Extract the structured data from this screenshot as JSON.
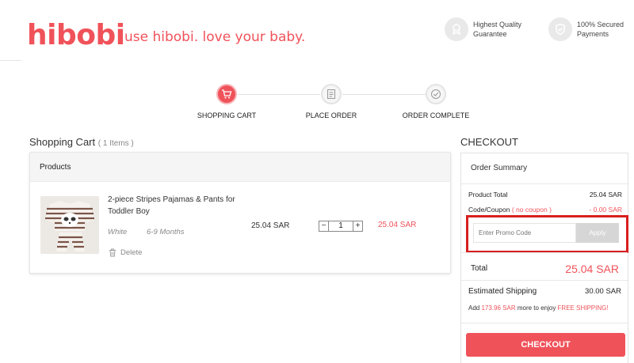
{
  "header": {
    "logo": "hibobi",
    "tagline": "use hibobi. love your baby.",
    "badges": [
      {
        "icon": "medal-icon",
        "line1": "Highest Quality",
        "line2": "Guarantee"
      },
      {
        "icon": "shield-check-icon",
        "line1": "100% Secured",
        "line2": "Payments"
      }
    ]
  },
  "steps": [
    {
      "label": "SHOPPING CART",
      "icon": "cart-icon",
      "active": true
    },
    {
      "label": "PLACE ORDER",
      "icon": "clipboard-icon",
      "active": false
    },
    {
      "label": "ORDER COMPLETE",
      "icon": "check-circle-icon",
      "active": false
    }
  ],
  "cart": {
    "title": "Shopping Cart",
    "count": "( 1 Items )",
    "column_header": "Products",
    "item": {
      "name": "2-piece Stripes Pajamas & Pants for Toddler Boy",
      "color": "White",
      "size": "6-9 Months",
      "delete_label": "Delete",
      "unit_price": "25.04 SAR",
      "quantity": "1",
      "minus": "−",
      "plus": "+",
      "line_price": "25.04 SAR"
    }
  },
  "checkout": {
    "title": "CHECKOUT",
    "summary_title": "Order Summary",
    "product_total_label": "Product Total",
    "product_total_value": "25.04 SAR",
    "coupon_label": "Code/Coupon",
    "coupon_note": "( no coupon )",
    "coupon_value": "- 0.00 SAR",
    "promo_placeholder": "Enter Promo Code",
    "apply_label": "Apply",
    "total_label": "Total",
    "total_value": "25.04 SAR",
    "shipping_label": "Estimated Shipping",
    "shipping_value": "30.00 SAR",
    "free_prefix": "Add",
    "free_amount": "173.96 SAR",
    "free_middle": "more to enjoy",
    "free_label": "FREE SHIPPING!",
    "button_label": "CHECKOUT"
  },
  "colors": {
    "brand": "#f0525a",
    "highlight": "#d81e1e",
    "disabled": "#d6d6d6"
  }
}
